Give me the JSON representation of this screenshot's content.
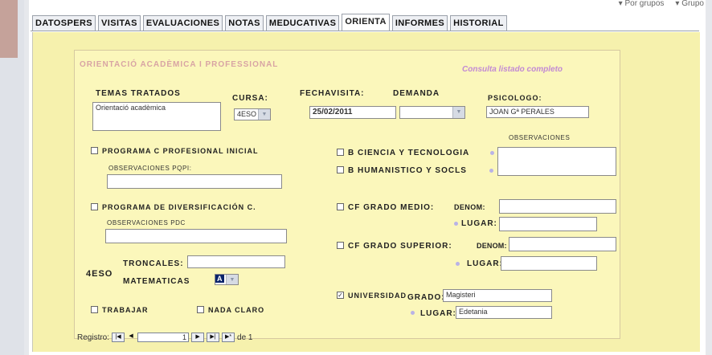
{
  "header": {
    "radio_groups_label": "Por grupos",
    "radio_group_label": "Grupo"
  },
  "tabs": [
    {
      "label": "DATOSPERS"
    },
    {
      "label": "VISITAS"
    },
    {
      "label": "EVALUACIONES"
    },
    {
      "label": "NOTAS"
    },
    {
      "label": "MEDUCATIVAS"
    },
    {
      "label": "ORIENTA"
    },
    {
      "label": "INFORMES"
    },
    {
      "label": "HISTORIAL"
    }
  ],
  "active_tab": "ORIENTA",
  "form": {
    "section_title": "ORIENTACIÓ ACADÈMICA I PROFESSIONAL",
    "consulta_link": "Consulta listado completo",
    "temas_label": "TEMAS TRATADOS",
    "temas_value": "Orientació acadèmica",
    "cursa_label": "CURSA:",
    "cursa_value": "4ESO",
    "fechavisita_label": "FECHAVISITA:",
    "fechavisita_value": "25/02/2011",
    "demanda_label": "DEMANDA",
    "demanda_value": "",
    "psicologo_label": "PSICOLOGO:",
    "psicologo_value": "JOAN Gª PERALES",
    "observaciones_label": "OBSERVACIONES",
    "pcpi_label": "PROGRAMA C PROFESIONAL INICIAL",
    "pcpi_obs_label": "OBSERVACIONES PQPI:",
    "pdc_label": "PROGRAMA DE DIVERSIFICACIÓN C.",
    "pdc_obs_label": "OBSERVACIONES PDC",
    "eso_label": "4ESO",
    "troncales_label": "TRONCALES:",
    "matematicas_label": "MATEMATICAS",
    "matematicas_value": "A",
    "trabajar_label": "TRABAJAR",
    "nada_claro_label": "NADA CLARO",
    "ciencia_label": "B CIENCIA Y TECNOLOGIA",
    "humanistico_label": "B HUMANISTICO Y SOCLS",
    "cf_medio_label": "CF GRADO MEDIO:",
    "cf_superior_label": "CF GRADO SUPERIOR:",
    "denom_label": "DENOM:",
    "lugar_label": "LUGAR:",
    "universidad_label": "UNIVERSIDAD",
    "universidad_checked": true,
    "grado_label": "GRADO:",
    "grado_value": "Magisteri",
    "uni_lugar_value": "Edetania"
  },
  "navigator": {
    "label": "Registro:",
    "current": "1",
    "of_label": "de 1"
  },
  "colors": {
    "panel": "#f6f1ad",
    "section_title": "#d8a4a4",
    "link": "#c28ad4",
    "dot": "#b9b3e6"
  }
}
